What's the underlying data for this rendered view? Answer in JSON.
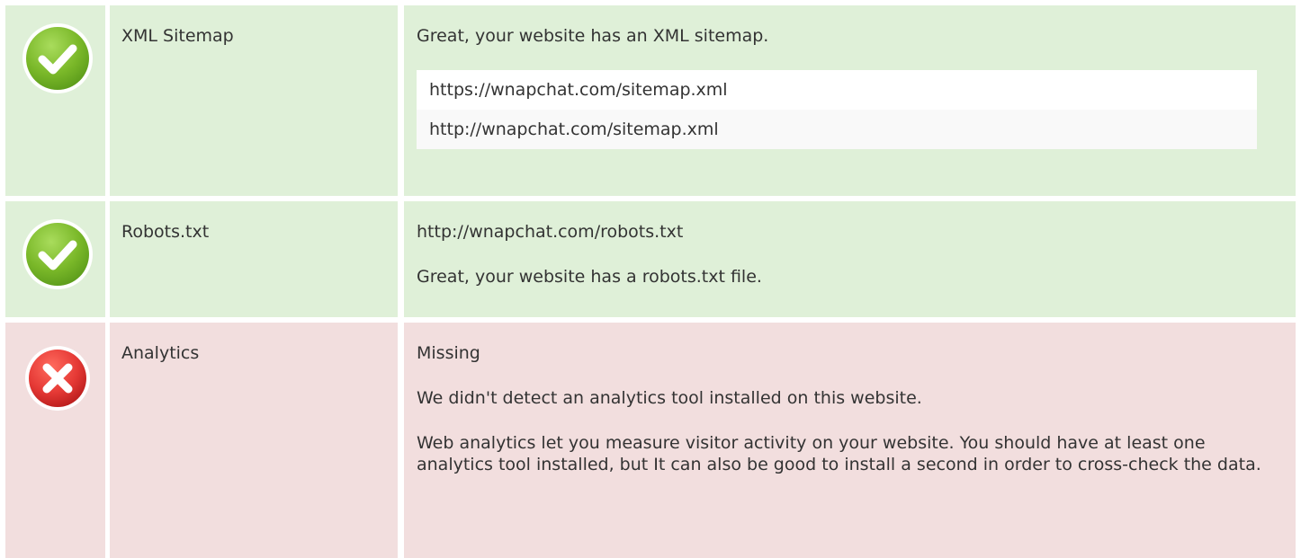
{
  "colors": {
    "pass_background": "#dff0d8",
    "fail_background": "#f2dede",
    "pass_icon": "#7ab829",
    "fail_icon": "#e53935"
  },
  "checks": [
    {
      "status": "pass",
      "icon": "check-icon",
      "label": "XML Sitemap",
      "message": "Great, your website has an XML sitemap.",
      "urls": [
        "https://wnapchat.com/sitemap.xml",
        "http://wnapchat.com/sitemap.xml"
      ]
    },
    {
      "status": "pass",
      "icon": "check-icon",
      "label": "Robots.txt",
      "url": "http://wnapchat.com/robots.txt",
      "message": "Great, your website has a robots.txt file."
    },
    {
      "status": "fail",
      "icon": "cross-icon",
      "label": "Analytics",
      "value": "Missing",
      "message": "We didn't detect an analytics tool installed on this website.",
      "advice": "Web analytics let you measure visitor activity on your website. You should have at least one analytics tool installed, but It can also be good to install a second in order to cross-check the data."
    }
  ]
}
